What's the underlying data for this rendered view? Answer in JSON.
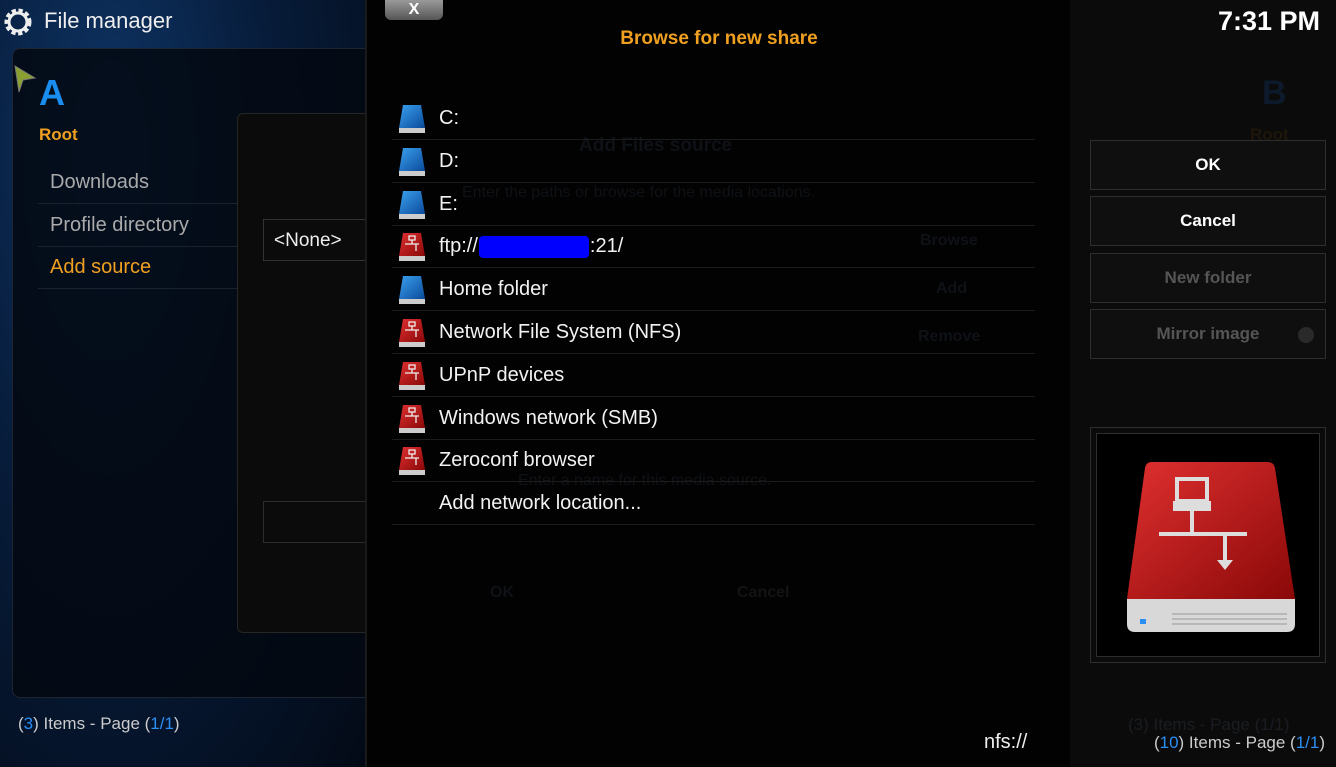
{
  "header": {
    "title": "File manager",
    "time": "7:31 PM"
  },
  "left_pane": {
    "label": "A",
    "path": "Root",
    "items": [
      {
        "label": "Downloads"
      },
      {
        "label": "Profile directory"
      },
      {
        "label": "Add source",
        "selected": true
      }
    ],
    "footer": {
      "open": "(",
      "count": "3",
      "mid": ") Items - Page (",
      "page": "1/1",
      "close": ")"
    }
  },
  "background_dialog": {
    "title": "Add Files source",
    "instruction": "Enter the paths or browse for the media locations.",
    "path_value": "<None>",
    "buttons": [
      "Browse",
      "Add",
      "Remove"
    ],
    "name_prompt": "Enter a name for this media source.",
    "ok": "OK",
    "cancel": "Cancel"
  },
  "browse_dialog": {
    "close_label": "X",
    "title": "Browse for new share",
    "items": [
      {
        "label": "C:",
        "icon": "drive-blue"
      },
      {
        "label": "D:",
        "icon": "drive-blue"
      },
      {
        "label": "E:",
        "icon": "drive-blue"
      },
      {
        "label_prefix": "ftp://",
        "label_suffix": ":21/",
        "icon": "network-drive-red",
        "redacted": true
      },
      {
        "label": "Home folder",
        "icon": "drive-blue"
      },
      {
        "label": "Network File System (NFS)",
        "icon": "network-drive-red"
      },
      {
        "label": "UPnP devices",
        "icon": "network-drive-red"
      },
      {
        "label": "Windows network (SMB)",
        "icon": "network-drive-red"
      },
      {
        "label": "Zeroconf browser",
        "icon": "network-drive-red"
      },
      {
        "label": "Add network location...",
        "icon": ""
      }
    ],
    "current_path": "nfs://",
    "buttons": [
      {
        "label": "OK",
        "enabled": true
      },
      {
        "label": "Cancel",
        "enabled": true
      },
      {
        "label": "New folder",
        "enabled": false
      },
      {
        "label": "Mirror image",
        "enabled": false
      }
    ],
    "footer": {
      "open": "(",
      "count": "10",
      "mid": ") Items - Page (",
      "page": "1/1",
      "close": ")"
    }
  },
  "right_pane": {
    "label": "B",
    "path": "Root",
    "footer": "(3) Items - Page (1/1)"
  },
  "colors": {
    "accent": "#f0a020",
    "blue": "#1a8ef0",
    "drive_red": "#b01010",
    "drive_blue": "#1060b0"
  }
}
